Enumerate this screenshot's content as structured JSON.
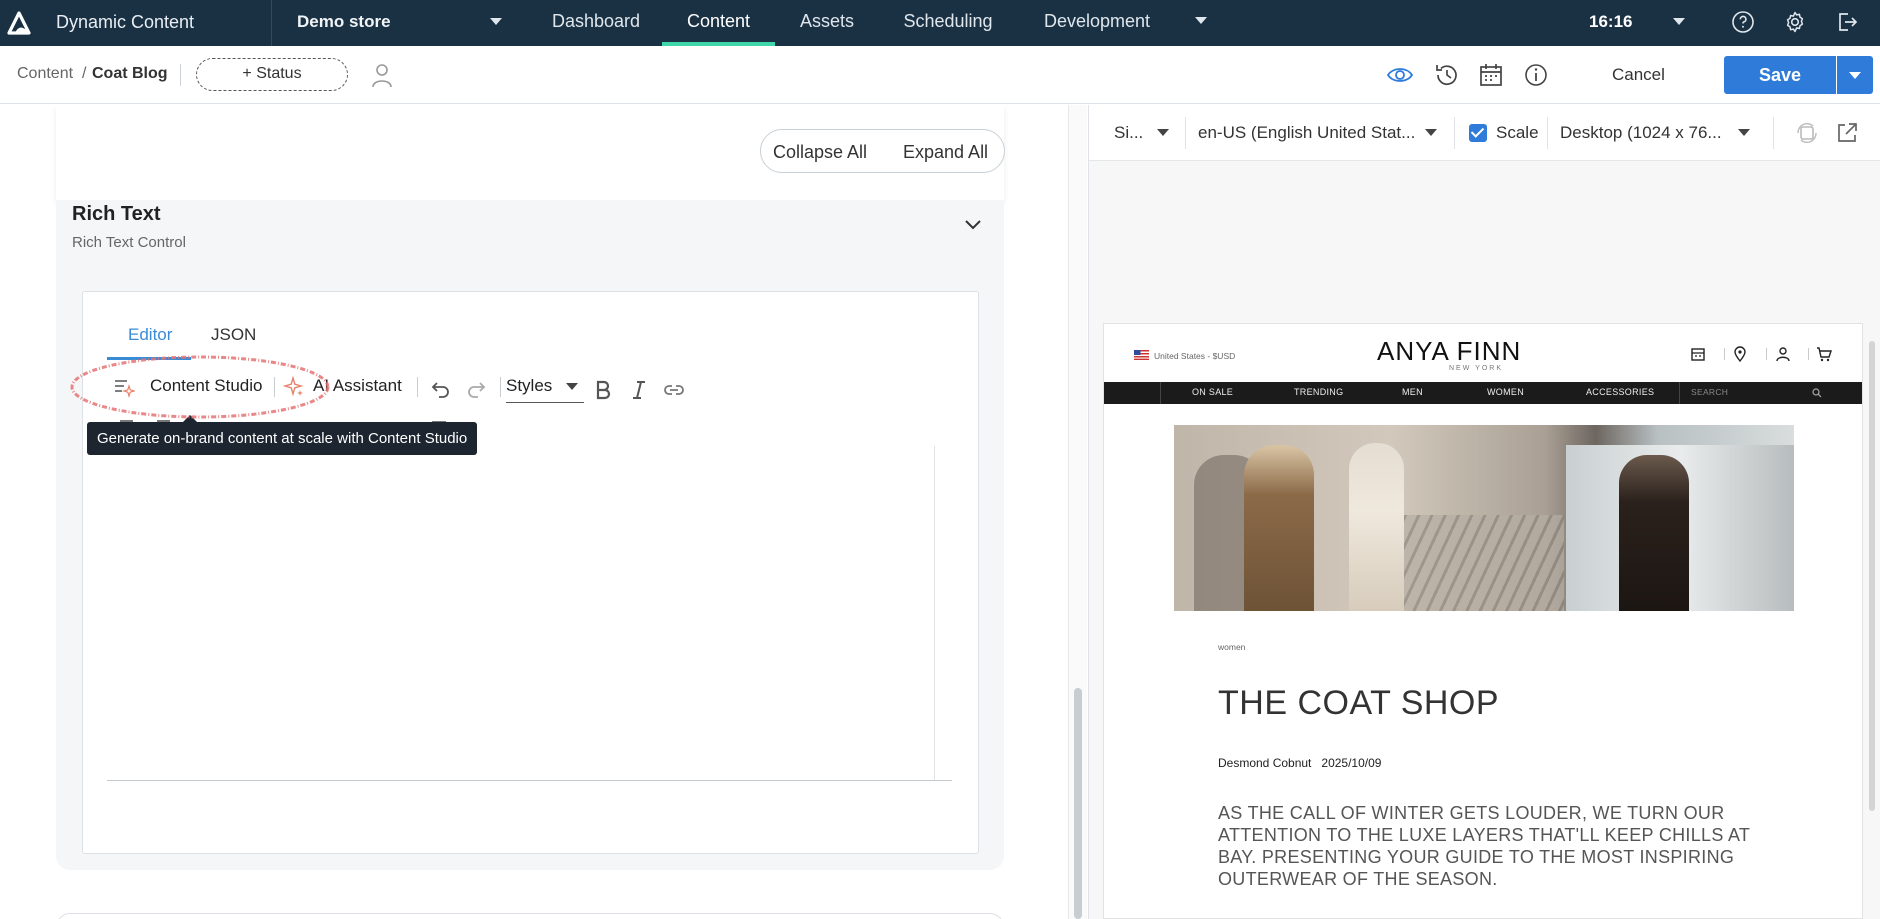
{
  "topbar": {
    "app_title": "Dynamic Content",
    "store": "Demo store",
    "nav": [
      "Dashboard",
      "Content",
      "Assets",
      "Scheduling",
      "Development"
    ],
    "active_tab": "Content",
    "clock": "16:16"
  },
  "subbar": {
    "breadcrumb_root": "Content",
    "breadcrumb_sep": "/",
    "breadcrumb_current": "Coat Blog",
    "status_button": "+ Status",
    "cancel": "Cancel",
    "save": "Save"
  },
  "editor": {
    "collapse_all": "Collapse All",
    "expand_all": "Expand All",
    "section_title": "Rich Text",
    "section_subtitle": "Rich Text Control",
    "tabs": [
      "Editor",
      "JSON"
    ],
    "toolbar": {
      "content_studio": "Content Studio",
      "ai_assistant": "AI Assistant",
      "styles": "Styles"
    },
    "tooltip": "Generate on-brand content at scale with Content Studio"
  },
  "preview": {
    "visualization": "Si...",
    "locale": "en-US (English United Stat...",
    "scale_label": "Scale",
    "scale_checked": true,
    "device": "Desktop (1024 x 76..."
  },
  "site": {
    "region": "United States - $USD",
    "brand": "ANYA FINN",
    "brand_sub": "NEW YORK",
    "menu": [
      "ON SALE",
      "TRENDING",
      "MEN",
      "WOMEN",
      "ACCESSORIES"
    ],
    "search_placeholder": "SEARCH",
    "category": "women",
    "post_title": "THE COAT SHOP",
    "author": "Desmond Cobnut",
    "date": "2025/10/09",
    "intro": "AS THE CALL OF WINTER GETS LOUDER, WE TURN OUR ATTENTION TO THE LUXE LAYERS THAT'LL KEEP CHILLS AT BAY. PRESENTING YOUR GUIDE TO THE MOST INSPIRING OUTERWEAR OF THE SEASON."
  },
  "colors": {
    "topbar_bg": "#1a3144",
    "active_tab_underline": "#3fd6a9",
    "primary": "#2e7bd9",
    "annotation": "#e57373"
  }
}
